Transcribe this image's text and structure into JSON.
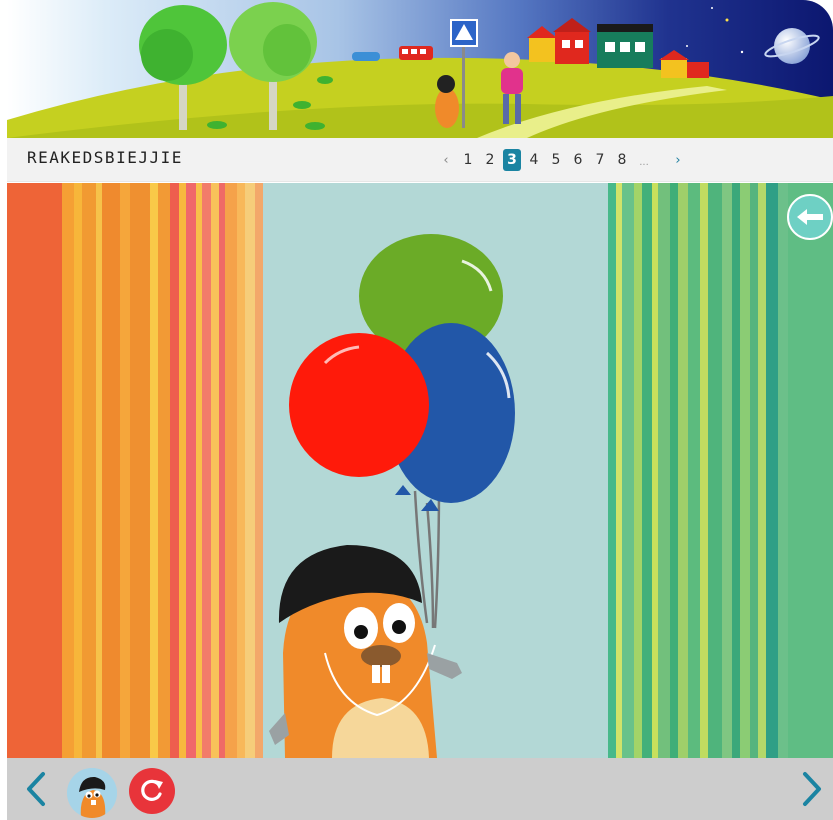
{
  "book": {
    "title": "REAKEDSBIEJJIE"
  },
  "pagination": {
    "prev_label": "‹",
    "next_label": "›",
    "pages": [
      "1",
      "2",
      "3",
      "4",
      "5",
      "6",
      "7",
      "8"
    ],
    "current_page": "3",
    "ellipsis": "..."
  },
  "icons": {
    "prev": "chevron-left-icon",
    "next": "chevron-right-icon",
    "back": "back-arrow-icon",
    "reload": "reload-icon",
    "avatar": "mole-avatar-icon"
  },
  "colors": {
    "accent": "#1b84a2",
    "reload": "#e8343a",
    "footer": "#cdcdcd",
    "titlebar": "#f2f2f2",
    "stage_bg": "#b3d8d6",
    "balloon_red": "#ff1a0a",
    "balloon_blue": "#2257a8",
    "balloon_green": "#6bab27",
    "mole": "#f08a2a"
  }
}
